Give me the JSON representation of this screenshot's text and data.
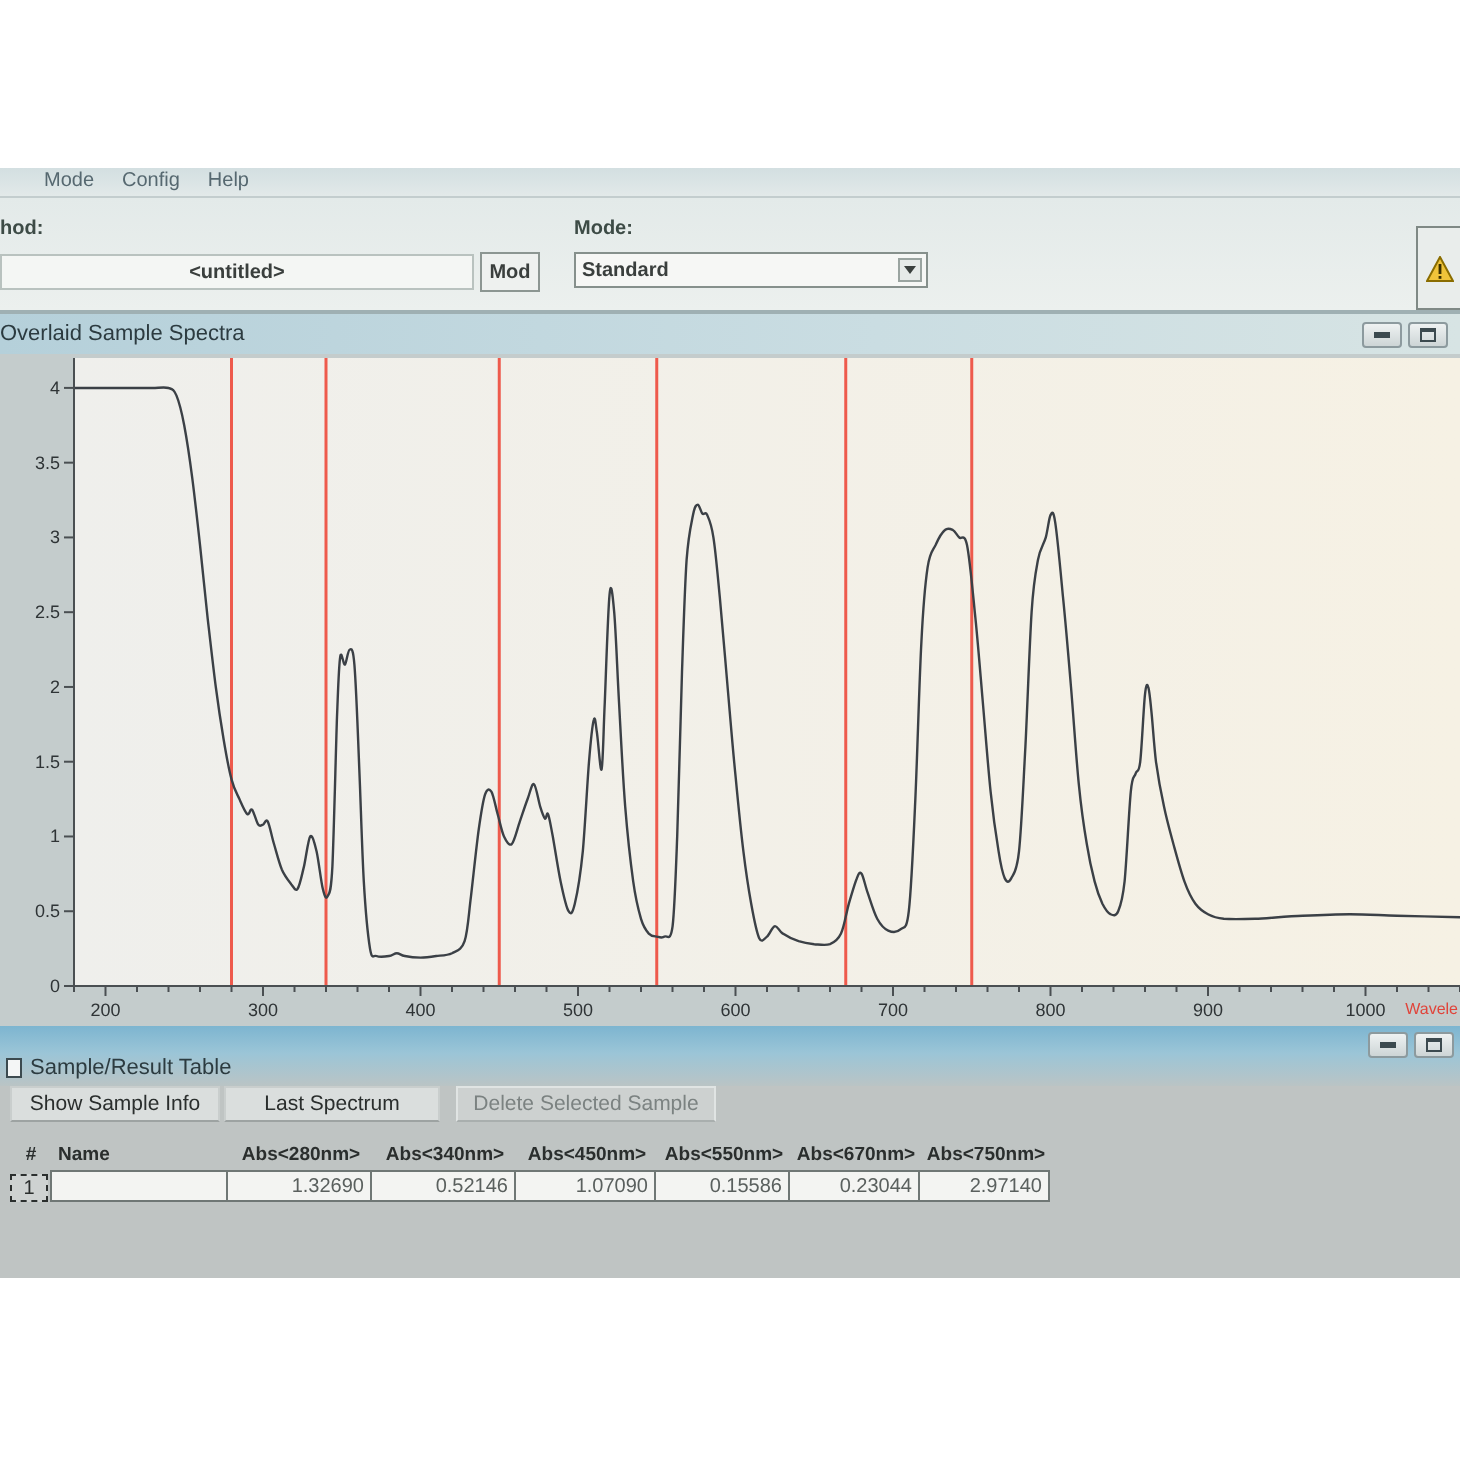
{
  "menu_bar": {
    "items": [
      "Mode",
      "Config",
      "Help"
    ]
  },
  "method_bar": {
    "method_label": "hod:",
    "method_value": "<untitled>",
    "modify_button": "Mod",
    "mode_label": "Mode:",
    "mode_value": "Standard"
  },
  "spectra_panel": {
    "title": "Overlaid Sample Spectra",
    "chart_data": {
      "type": "line",
      "xlabel": "Wavele",
      "x": [
        180,
        190,
        200,
        210,
        220,
        230,
        240,
        245,
        250,
        255,
        260,
        265,
        270,
        275,
        280,
        285,
        290,
        293,
        297,
        300,
        303,
        307,
        312,
        318,
        322,
        326,
        330,
        334,
        338,
        341,
        344,
        347,
        349,
        352,
        355,
        358,
        361,
        364,
        368,
        372,
        380,
        385,
        390,
        400,
        410,
        420,
        428,
        432,
        437,
        441,
        445,
        449,
        453,
        458,
        463,
        468,
        472,
        476,
        479,
        481,
        484,
        489,
        494,
        498,
        503,
        507,
        510,
        512,
        515,
        517,
        520,
        523,
        526,
        530,
        535,
        540,
        545,
        550,
        555,
        560,
        563,
        566,
        569,
        573,
        576,
        579,
        582,
        586,
        590,
        595,
        600,
        605,
        610,
        615,
        620,
        625,
        630,
        640,
        650,
        660,
        667,
        672,
        677,
        680,
        684,
        690,
        697,
        705,
        710,
        714,
        718,
        722,
        727,
        733,
        738,
        742,
        747,
        752,
        757,
        762,
        767,
        771,
        775,
        780,
        784,
        788,
        792,
        797,
        800,
        803,
        808,
        813,
        818,
        823,
        828,
        833,
        838,
        843,
        847,
        851,
        854,
        857,
        860,
        862,
        864,
        867,
        872,
        878,
        885,
        892,
        900,
        910,
        930,
        960,
        990,
        1020,
        1060
      ],
      "values": [
        4,
        4,
        4,
        4,
        4,
        4,
        4,
        3.95,
        3.75,
        3.4,
        2.95,
        2.45,
        2.0,
        1.65,
        1.38,
        1.25,
        1.15,
        1.18,
        1.08,
        1.08,
        1.1,
        0.95,
        0.78,
        0.68,
        0.65,
        0.8,
        1.0,
        0.9,
        0.65,
        0.6,
        0.8,
        1.8,
        2.2,
        2.15,
        2.25,
        2.15,
        1.5,
        0.7,
        0.25,
        0.2,
        0.2,
        0.22,
        0.2,
        0.19,
        0.2,
        0.22,
        0.3,
        0.6,
        1.05,
        1.28,
        1.3,
        1.15,
        1.0,
        0.95,
        1.1,
        1.25,
        1.35,
        1.2,
        1.12,
        1.15,
        1.0,
        0.7,
        0.5,
        0.55,
        0.9,
        1.5,
        1.78,
        1.7,
        1.45,
        1.9,
        2.62,
        2.5,
        1.9,
        1.2,
        0.7,
        0.45,
        0.35,
        0.33,
        0.33,
        0.4,
        1.0,
        2.1,
        2.85,
        3.15,
        3.22,
        3.16,
        3.15,
        3.0,
        2.6,
        2.0,
        1.4,
        0.9,
        0.55,
        0.32,
        0.33,
        0.4,
        0.35,
        0.3,
        0.28,
        0.28,
        0.35,
        0.55,
        0.72,
        0.75,
        0.62,
        0.45,
        0.37,
        0.38,
        0.5,
        1.2,
        2.3,
        2.8,
        2.95,
        3.05,
        3.05,
        3.0,
        2.95,
        2.5,
        1.9,
        1.3,
        0.9,
        0.72,
        0.72,
        0.9,
        1.6,
        2.5,
        2.85,
        3.0,
        3.15,
        3.1,
        2.6,
        2.0,
        1.35,
        0.95,
        0.7,
        0.55,
        0.48,
        0.5,
        0.7,
        1.3,
        1.42,
        1.5,
        1.95,
        2.0,
        1.85,
        1.5,
        1.2,
        0.95,
        0.7,
        0.55,
        0.48,
        0.45,
        0.45,
        0.47,
        0.48,
        0.47,
        0.46
      ],
      "xlim": [
        180,
        1060
      ],
      "ylim": [
        0,
        4.2
      ],
      "xticks": [
        200,
        300,
        400,
        500,
        600,
        700,
        800,
        900,
        1000
      ],
      "yticks": [
        0,
        0.5,
        1,
        1.5,
        2,
        2.5,
        3,
        3.5,
        4
      ],
      "ref_lines": [
        {
          "axis": "x",
          "value": 280
        },
        {
          "axis": "x",
          "value": 340
        },
        {
          "axis": "x",
          "value": 450
        },
        {
          "axis": "x",
          "value": 550
        },
        {
          "axis": "x",
          "value": 670
        },
        {
          "axis": "x",
          "value": 750
        }
      ]
    }
  },
  "result_table": {
    "title": "Sample/Result Table",
    "buttons": [
      {
        "label": "Show Sample Info",
        "disabled": false
      },
      {
        "label": "Last Spectrum",
        "disabled": false
      },
      {
        "label": "Delete Selected Sample",
        "disabled": true
      }
    ],
    "columns": [
      "#",
      "Name",
      "Abs<280nm>",
      "Abs<340nm>",
      "Abs<450nm>",
      "Abs<550nm>",
      "Abs<670nm>",
      "Abs<750nm>"
    ],
    "rows": [
      {
        "index": "1",
        "focused": true,
        "values": [
          "1.32690",
          "0.52146",
          "1.07090",
          "0.15586",
          "0.23044",
          "2.97140"
        ]
      }
    ]
  }
}
